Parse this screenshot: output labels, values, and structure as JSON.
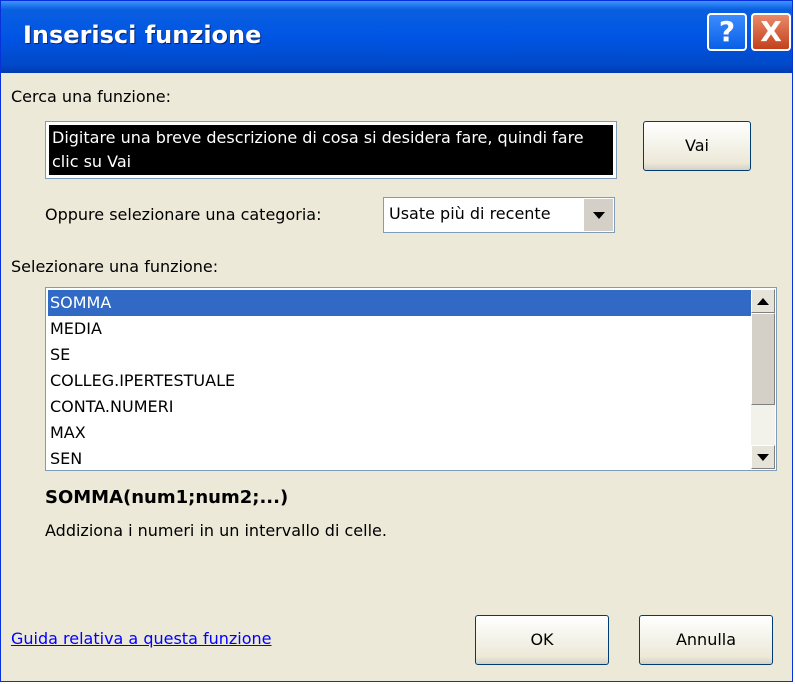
{
  "window": {
    "title": "Inserisci funzione",
    "help_glyph": "?",
    "close_glyph": "X"
  },
  "search": {
    "label": "Cerca una funzione:",
    "text": "Digitare una breve descrizione di cosa si desidera fare, quindi fare clic su Vai",
    "go_button": "Vai"
  },
  "category": {
    "label": "Oppure selezionare una categoria:",
    "selected": "Usate più di recente"
  },
  "functions": {
    "label": "Selezionare una funzione:",
    "items": [
      "SOMMA",
      "MEDIA",
      "SE",
      "COLLEG.IPERTESTUALE",
      "CONTA.NUMERI",
      "MAX",
      "SEN"
    ],
    "selected_index": 0
  },
  "details": {
    "signature": "SOMMA(num1;num2;...)",
    "description": "Addiziona i numeri in un intervallo di celle."
  },
  "footer": {
    "help_link": "Guida relativa a questa funzione",
    "ok": "OK",
    "cancel": "Annulla"
  },
  "colors": {
    "titlebar": "#0055e5",
    "dialog_bg": "#ece9d8",
    "selection": "#316ac5",
    "link": "#0000ff"
  }
}
